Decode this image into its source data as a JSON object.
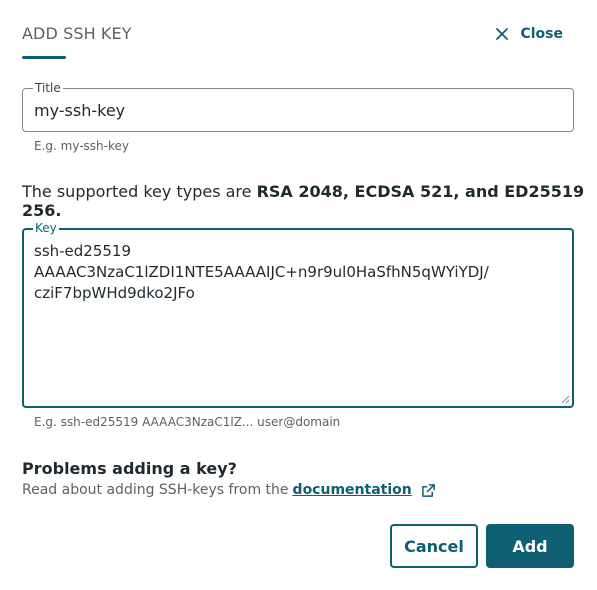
{
  "dialog": {
    "title": "ADD SSH KEY",
    "close_label": "Close"
  },
  "title_field": {
    "label": "Title",
    "value": "my-ssh-key",
    "hint": "E.g. my-ssh-key"
  },
  "supported": {
    "prefix": "The supported key types are ",
    "types": "RSA 2048, ECDSA 521, and ED25519 256."
  },
  "key_field": {
    "label": "Key",
    "value": "ssh-ed25519\nAAAAC3NzaC1lZDI1NTE5AAAAIJC+n9r9ul0HaSfhN5qWYiYDJ/\ncziF7bpWHd9dko2JFo",
    "hint": "E.g. ssh-ed25519 AAAAC3NzaC1lZ... user@domain"
  },
  "help": {
    "title": "Problems adding a key?",
    "text": "Read about adding SSH-keys from the",
    "link": "documentation"
  },
  "actions": {
    "cancel": "Cancel",
    "add": "Add"
  },
  "icons": {
    "close": "close-icon",
    "external_link": "external-link-icon",
    "resize": "resize-handle-icon"
  },
  "colors": {
    "accent": "#0e5f72",
    "text": "#1f2a30",
    "muted": "#5a6268",
    "border": "#808a90"
  }
}
